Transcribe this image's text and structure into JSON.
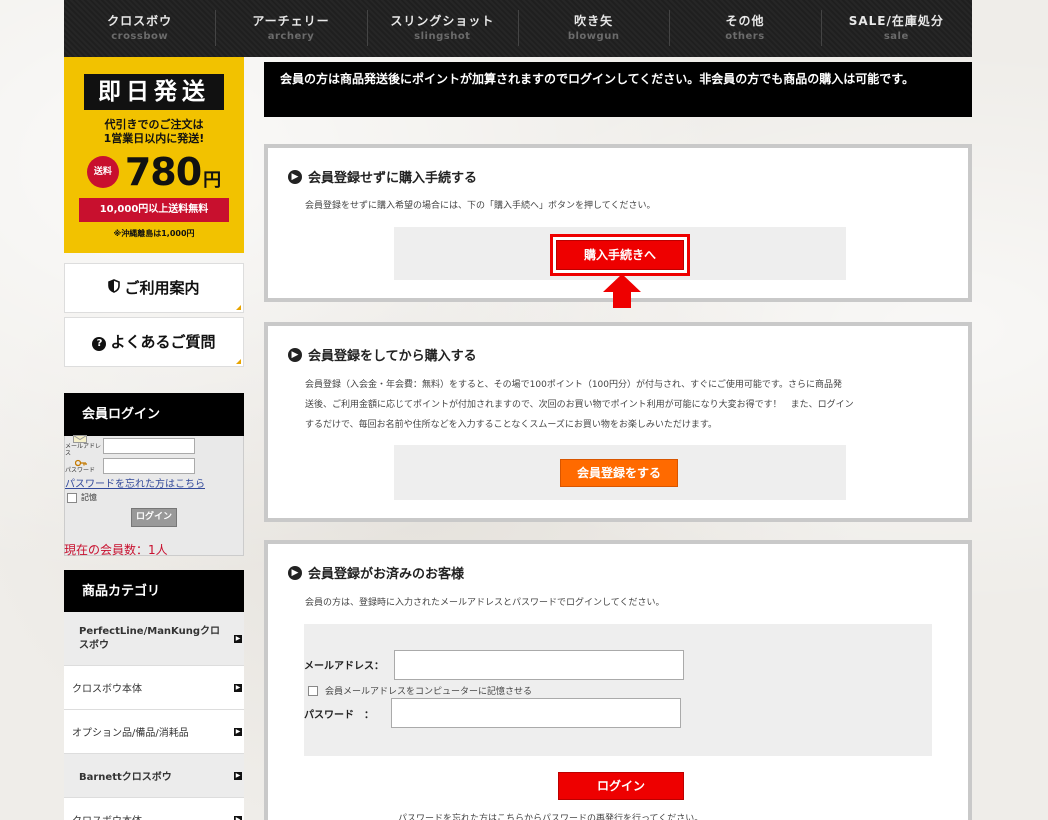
{
  "nav": [
    {
      "jp": "クロスボウ",
      "en": "crossbow"
    },
    {
      "jp": "アーチェリー",
      "en": "archery"
    },
    {
      "jp": "スリングショット",
      "en": "slingshot"
    },
    {
      "jp": "吹き矢",
      "en": "blowgun"
    },
    {
      "jp": "その他",
      "en": "others"
    },
    {
      "jp": "SALE/在庫処分",
      "en": "sale"
    }
  ],
  "promo": {
    "title": "即日発送",
    "sub_line1": "代引きでのご注文は",
    "sub_line2": "1営業日以内に発送!",
    "ship_badge": "送料",
    "price": "780",
    "yen": "円",
    "free": "10,000円以上送料無料",
    "note": "※沖縄離島は1,000円"
  },
  "side": {
    "guide": "ご利用案内",
    "faq": "よくあるご質問",
    "login_head": "会員ログイン",
    "email_label": "メールアドレス",
    "password_label": "パスワード",
    "forgot": "パスワードを忘れた方はこちら",
    "remember": "記憶",
    "login_btn": "ログイン",
    "member_count": "現在の会員数：1人",
    "category_head": "商品カテゴリ",
    "categories": [
      "PerfectLine/ManKungクロスボウ",
      "クロスボウ本体",
      "オプション品/備品/消耗品",
      "Barnettクロスボウ",
      "クロスボウ本体"
    ]
  },
  "main": {
    "notice": "会員の方は商品発送後にポイントが加算されますのでログインしてください。非会員の方でも商品の購入は可能です。",
    "guest": {
      "title": "会員登録せずに購入手続する",
      "desc": "会員登録をせずに購入希望の場合には、下の「購入手続へ」ボタンを押してください。",
      "button": "購入手続きへ"
    },
    "register": {
      "title": "会員登録をしてから購入する",
      "desc_line1": "会員登録（入会金・年会費：無料）をすると、その場で100ポイント（100円分）が付与され、すぐにご使用可能です。さらに商品発",
      "desc_line2": "送後、ご利用金額に応じてポイントが付加されますので、次回のお買い物でポイント利用が可能になり大変お得です！　また、ログイン",
      "desc_line3": "するだけで、毎回お名前や住所などを入力することなくスムーズにお買い物をお楽しみいただけます。",
      "button": "会員登録をする"
    },
    "member": {
      "title": "会員登録がお済みのお客様",
      "desc": "会員の方は、登録時に入力されたメールアドレスとパスワードでログインしてください。",
      "email_label": "メールアドレス：",
      "remember": "会員メールアドレスをコンピューターに記憶させる",
      "password_label": "パスワード　：",
      "button": "ログイン",
      "footer": "パスワードを忘れた方はこちらからパスワードの再発行を行ってください。"
    }
  },
  "colors": {
    "accent_red": "#ee0000",
    "accent_orange": "#ff6a00",
    "promo_yellow": "#f2c200"
  }
}
